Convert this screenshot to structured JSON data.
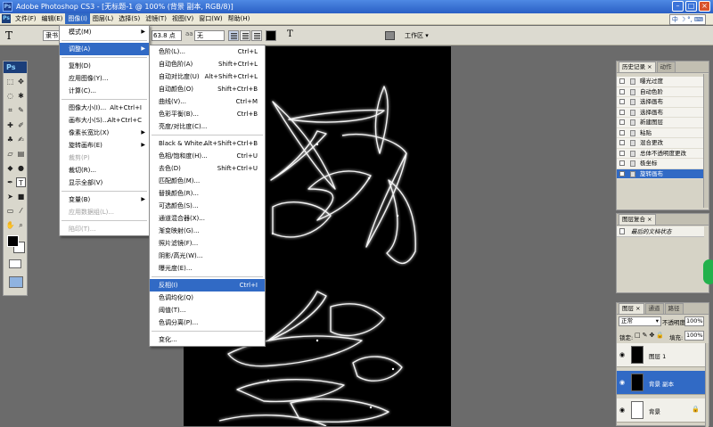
{
  "window": {
    "title": "Adobe Photoshop CS3 - [无标题-1 @ 100% (背景 副本, RGB/8)]",
    "app_badge": "Ps"
  },
  "menubar": {
    "items": [
      "文件(F)",
      "编辑(E)",
      "图像(I)",
      "图层(L)",
      "选择(S)",
      "滤镜(T)",
      "视图(V)",
      "窗口(W)",
      "帮助(H)"
    ],
    "active_index": 2
  },
  "ime": {
    "chars": [
      "中",
      "☽",
      "°,",
      "⌨"
    ]
  },
  "options": {
    "tool_glyph": "T",
    "font": "隶书",
    "size": "63.8 点",
    "aa_label": "aa",
    "aa_mode": "无",
    "workspace": "工作区"
  },
  "image_menu": {
    "items": [
      {
        "label": "模式(M)",
        "shortcut": "",
        "submenu": true,
        "disabled": false
      },
      {
        "sep": true
      },
      {
        "label": "调整(A)",
        "shortcut": "",
        "submenu": true,
        "highlight": true
      },
      {
        "sep": true
      },
      {
        "label": "复制(D)",
        "shortcut": ""
      },
      {
        "label": "应用图像(Y)...",
        "shortcut": ""
      },
      {
        "label": "计算(C)...",
        "shortcut": ""
      },
      {
        "sep": true
      },
      {
        "label": "图像大小(I)...",
        "shortcut": "Alt+Ctrl+I"
      },
      {
        "label": "画布大小(S)...",
        "shortcut": "Alt+Ctrl+C"
      },
      {
        "label": "像素长宽比(X)",
        "shortcut": "",
        "submenu": true
      },
      {
        "label": "旋转画布(E)",
        "shortcut": "",
        "submenu": true
      },
      {
        "label": "裁剪(P)",
        "shortcut": "",
        "disabled": true
      },
      {
        "label": "裁切(R)...",
        "shortcut": ""
      },
      {
        "label": "显示全部(V)",
        "shortcut": ""
      },
      {
        "sep": true
      },
      {
        "label": "变量(B)",
        "shortcut": "",
        "submenu": true
      },
      {
        "label": "应用数据组(L)...",
        "shortcut": "",
        "disabled": true
      },
      {
        "sep": true
      },
      {
        "label": "陷印(T)...",
        "shortcut": "",
        "disabled": true
      }
    ]
  },
  "adjust_menu": {
    "items": [
      {
        "label": "色阶(L)...",
        "shortcut": "Ctrl+L"
      },
      {
        "label": "自动色阶(A)",
        "shortcut": "Shift+Ctrl+L"
      },
      {
        "label": "自动对比度(U)",
        "shortcut": "Alt+Shift+Ctrl+L"
      },
      {
        "label": "自动颜色(O)",
        "shortcut": "Shift+Ctrl+B"
      },
      {
        "label": "曲线(V)...",
        "shortcut": "Ctrl+M"
      },
      {
        "label": "色彩平衡(B)...",
        "shortcut": "Ctrl+B"
      },
      {
        "label": "亮度/对比度(C)...",
        "shortcut": ""
      },
      {
        "sep": true
      },
      {
        "label": "Black & White...",
        "shortcut": "Alt+Shift+Ctrl+B"
      },
      {
        "label": "色相/饱和度(H)...",
        "shortcut": "Ctrl+U"
      },
      {
        "label": "去色(D)",
        "shortcut": "Shift+Ctrl+U"
      },
      {
        "label": "匹配颜色(M)...",
        "shortcut": ""
      },
      {
        "label": "替换颜色(R)...",
        "shortcut": ""
      },
      {
        "label": "可选颜色(S)...",
        "shortcut": ""
      },
      {
        "label": "通道混合器(X)...",
        "shortcut": ""
      },
      {
        "label": "渐变映射(G)...",
        "shortcut": ""
      },
      {
        "label": "照片滤镜(F)...",
        "shortcut": ""
      },
      {
        "label": "阴影/高光(W)...",
        "shortcut": ""
      },
      {
        "label": "曝光度(E)...",
        "shortcut": ""
      },
      {
        "sep": true
      },
      {
        "label": "反相(I)",
        "shortcut": "Ctrl+I",
        "highlight": true
      },
      {
        "label": "色调均化(Q)",
        "shortcut": ""
      },
      {
        "label": "阈值(T)...",
        "shortcut": ""
      },
      {
        "label": "色调分离(P)...",
        "shortcut": ""
      },
      {
        "sep": true
      },
      {
        "label": "变化...",
        "shortcut": ""
      }
    ]
  },
  "history_panel": {
    "tabs": [
      "历史记录 ×",
      "动作"
    ],
    "items": [
      "曝光过度",
      "自动色阶",
      "选择画布",
      "选择画布",
      "新建图层",
      "粘贴",
      "混合更改",
      "总体不透明度更改",
      "极坐标",
      "旋转画布"
    ],
    "selected_index": 9
  },
  "layer_comps_panel": {
    "tabs": [
      "图层复合 ×"
    ],
    "item": "最后的文档状态"
  },
  "layers_panel": {
    "tabs": [
      "图层 ×",
      "通道",
      "路径"
    ],
    "blend_mode": "正常",
    "opacity_label": "不透明度:",
    "opacity": "100%",
    "lock_label": "锁定:",
    "fill_label": "填充:",
    "fill": "100%",
    "layers": [
      {
        "name": "图层 1",
        "thumb": "black",
        "selected": false,
        "locked": false
      },
      {
        "name": "背景 副本",
        "thumb": "black",
        "selected": true,
        "locked": false
      },
      {
        "name": "背景",
        "thumb": "white",
        "selected": false,
        "locked": true
      }
    ]
  }
}
